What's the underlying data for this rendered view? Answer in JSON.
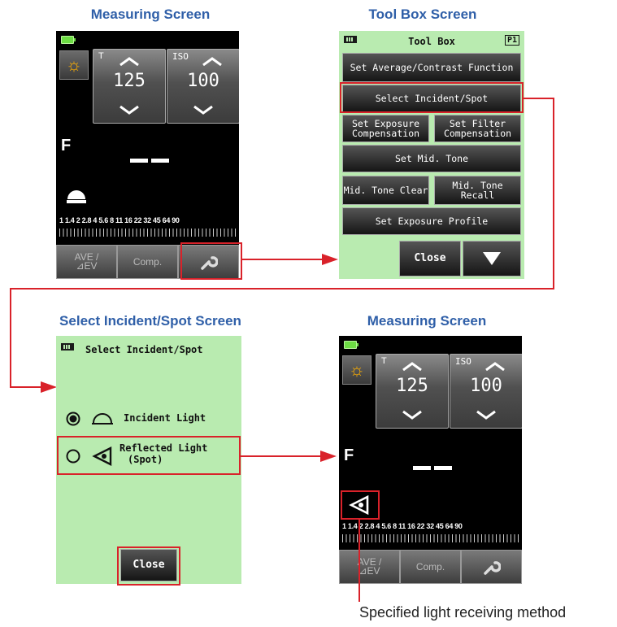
{
  "captions": {
    "top_left": "Measuring Screen",
    "top_right": "Tool Box Screen",
    "bottom_left": "Select Incident/Spot Screen",
    "bottom_right": "Measuring Screen"
  },
  "measuring": {
    "t_label": "T",
    "t_value": "125",
    "iso_label": "ISO",
    "iso_value": "100",
    "f_label": "F",
    "scale": "1  1.4  2  2.8  4  5.6  8  11  16  22  32  45  64  90",
    "ave_label_1": "AVE /",
    "ave_label_2": "⊿EV",
    "comp_label": "Comp."
  },
  "toolbox": {
    "title": "Tool Box",
    "page": "P1",
    "btn_avg_contrast": "Set Average/Contrast Function",
    "btn_incident_spot": "Select Incident/Spot",
    "btn_exp_comp": "Set Exposure Compensation",
    "btn_filter_comp": "Set Filter Compensation",
    "btn_mid_tone": "Set Mid. Tone",
    "btn_mid_clear": "Mid. Tone Clear",
    "btn_mid_recall": "Mid. Tone Recall",
    "btn_exp_profile": "Set Exposure Profile",
    "btn_close": "Close"
  },
  "select": {
    "title": "Select Incident/Spot",
    "opt_incident": "Incident Light",
    "opt_reflected_1": "Reflected Light",
    "opt_reflected_2": "(Spot)",
    "btn_close": "Close"
  },
  "annotation": "Specified light receiving method",
  "colors": {
    "caption": "#2f5fa8",
    "highlight": "#d9222a",
    "green_screen": "#b9ebb0",
    "battery": "#6ddc44"
  }
}
